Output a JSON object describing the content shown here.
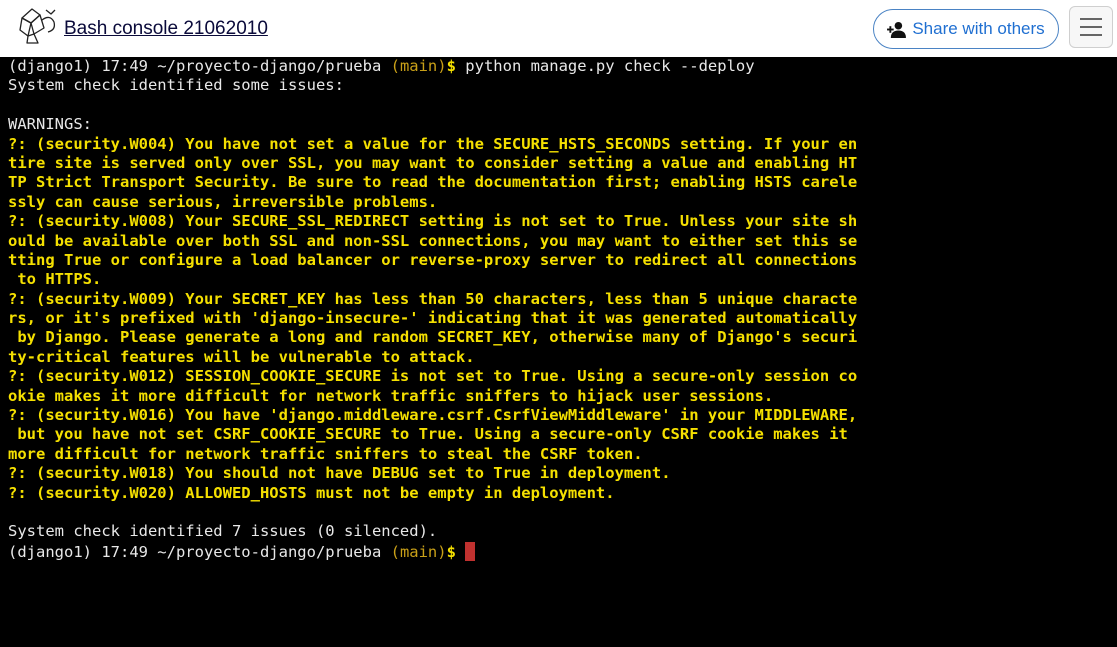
{
  "header": {
    "title": "Bash console 21062010",
    "share_label": "Share with others",
    "logo_icon": "pythonanywhere-logo-icon",
    "share_icon": "add-user-icon",
    "menu_icon": "hamburger-menu-icon"
  },
  "colors": {
    "terminal_bg": "#000000",
    "terminal_text": "#e8e8e8",
    "warning_text": "#f5e000",
    "branch_text": "#c9a018",
    "cursor": "#c0312f",
    "share_accent": "#1f6fd1"
  },
  "terminal": {
    "prompt_env_path": "(django1) 17:49 ~/proyecto-django/prueba ",
    "prompt_branch": "(main)",
    "prompt_symbol": "$ ",
    "command": "python manage.py check --deploy",
    "line_identified": "System check identified some issues:",
    "warnings_header": "WARNINGS:",
    "warnings": [
      "?: (security.W004) You have not set a value for the SECURE_HSTS_SECONDS setting. If your en",
      "tire site is served only over SSL, you may want to consider setting a value and enabling HT",
      "TP Strict Transport Security. Be sure to read the documentation first; enabling HSTS carele",
      "ssly can cause serious, irreversible problems.",
      "?: (security.W008) Your SECURE_SSL_REDIRECT setting is not set to True. Unless your site sh",
      "ould be available over both SSL and non-SSL connections, you may want to either set this se",
      "tting True or configure a load balancer or reverse-proxy server to redirect all connections",
      " to HTTPS.",
      "?: (security.W009) Your SECRET_KEY has less than 50 characters, less than 5 unique characte",
      "rs, or it's prefixed with 'django-insecure-' indicating that it was generated automatically",
      " by Django. Please generate a long and random SECRET_KEY, otherwise many of Django's securi",
      "ty-critical features will be vulnerable to attack.",
      "?: (security.W012) SESSION_COOKIE_SECURE is not set to True. Using a secure-only session co",
      "okie makes it more difficult for network traffic sniffers to hijack user sessions.",
      "?: (security.W016) You have 'django.middleware.csrf.CsrfViewMiddleware' in your MIDDLEWARE,",
      " but you have not set CSRF_COOKIE_SECURE to True. Using a secure-only CSRF cookie makes it",
      "more difficult for network traffic sniffers to steal the CSRF token.",
      "?: (security.W018) You should not have DEBUG set to True in deployment.",
      "?: (security.W020) ALLOWED_HOSTS must not be empty in deployment."
    ],
    "summary": "System check identified 7 issues (0 silenced)."
  }
}
